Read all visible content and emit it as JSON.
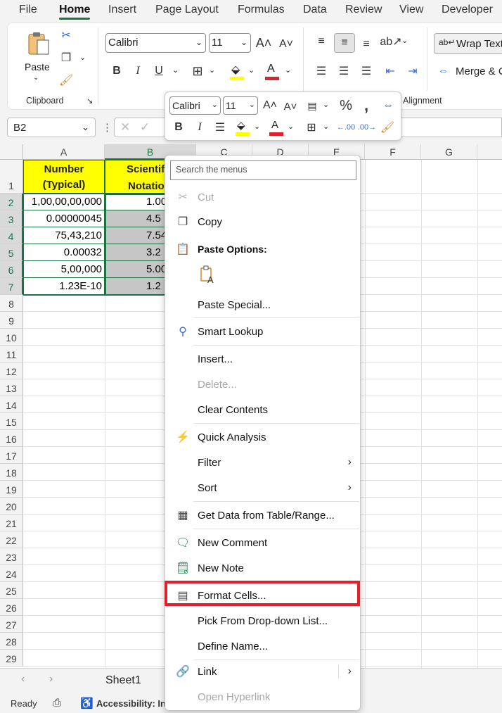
{
  "menubar": {
    "tabs": [
      "File",
      "Home",
      "Insert",
      "Page Layout",
      "Formulas",
      "Data",
      "Review",
      "View",
      "Developer"
    ],
    "active": "Home"
  },
  "ribbon": {
    "clipboard": {
      "paste_label": "Paste",
      "group_label": "Clipboard"
    },
    "font": {
      "name": "Calibri",
      "size": "11"
    },
    "alignment": {
      "wrap_text": "Wrap Text",
      "merge": "Merge & C",
      "group_label": "Alignment"
    }
  },
  "formula_bar": {
    "name_box": "B2"
  },
  "minibar": {
    "font": "Calibri",
    "size": "11"
  },
  "grid": {
    "columns": [
      "A",
      "B",
      "C",
      "D",
      "E",
      "F",
      "G"
    ],
    "rows": [
      "1",
      "2",
      "3",
      "4",
      "5",
      "6",
      "7",
      "8",
      "9",
      "10",
      "11",
      "12",
      "13",
      "14",
      "15",
      "16",
      "17",
      "18",
      "19",
      "20",
      "21",
      "22",
      "23",
      "24",
      "25",
      "26",
      "27",
      "28",
      "29"
    ],
    "header_a_line1": "Number",
    "header_a_line2": "(Typical)",
    "header_b_line1": "Scientif",
    "header_b_line2": "Notatio",
    "col_a": [
      "1,00,00,00,000",
      "0.00000045",
      "75,43,210",
      "0.00032",
      "5,00,000",
      "1.23E-10"
    ],
    "col_b": [
      "1.00",
      "4.5",
      "7.54",
      "3.2",
      "5.00",
      "1.2"
    ]
  },
  "context_menu": {
    "search_placeholder": "Search the menus",
    "cut": "Cut",
    "copy": "Copy",
    "paste_options": "Paste Options:",
    "paste_special": "Paste Special...",
    "smart_lookup": "Smart Lookup",
    "insert": "Insert...",
    "delete": "Delete...",
    "clear_contents": "Clear Contents",
    "quick_analysis": "Quick Analysis",
    "filter": "Filter",
    "sort": "Sort",
    "get_data": "Get Data from Table/Range...",
    "new_comment": "New Comment",
    "new_note": "New Note",
    "format_cells": "Format Cells...",
    "pick_dropdown": "Pick From Drop-down List...",
    "define_name": "Define Name...",
    "link": "Link",
    "open_hyperlink": "Open Hyperlink"
  },
  "sheet_tabs": {
    "sheet1": "Sheet1"
  },
  "status": {
    "ready": "Ready",
    "accessibility": "Accessibility: In"
  },
  "colors": {
    "accent": "#1e7145",
    "header_fill": "#ffff00",
    "selection_fill": "#c6c6c6",
    "highlight": "#e0202c"
  }
}
